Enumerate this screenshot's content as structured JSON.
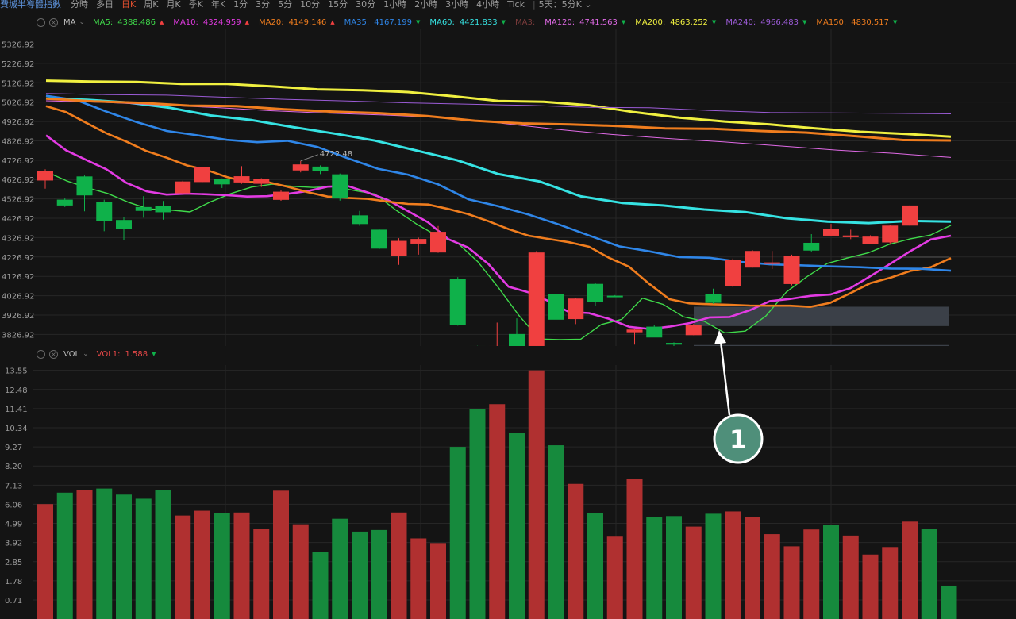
{
  "header": {
    "title": "費城半導體指數",
    "timeframes": [
      "分時",
      "多日",
      "日K",
      "周K",
      "月K",
      "季K",
      "年K",
      "1分",
      "3分",
      "5分",
      "10分",
      "15分",
      "30分",
      "1小時",
      "2小時",
      "3小時",
      "4小時",
      "Tick"
    ],
    "active_timeframe": "日K",
    "range_label": "5天：5分K",
    "range_chevron": "⌄"
  },
  "price_legend": {
    "label": "MA",
    "items": [
      {
        "name": "MA5:",
        "value": "4388.486",
        "color": "#3fd94a",
        "dir": "▲"
      },
      {
        "name": "MA10:",
        "value": "4324.959",
        "color": "#e33be3",
        "dir": "▲"
      },
      {
        "name": "MA20:",
        "value": "4149.146",
        "color": "#f07d1e",
        "dir": "▲"
      },
      {
        "name": "MA35:",
        "value": "4167.199",
        "color": "#2f86e8",
        "dir": "▼"
      },
      {
        "name": "MA60:",
        "value": "4421.833",
        "color": "#36e3e3",
        "dir": "▼"
      },
      {
        "name": "MA3:",
        "value": "",
        "color": "#7a3b3b",
        "dir": ""
      },
      {
        "name": "MA120:",
        "value": "4741.563",
        "color": "#e06ae6",
        "dir": "▼"
      },
      {
        "name": "MA200:",
        "value": "4863.252",
        "color": "#f0f040",
        "dir": "▼"
      },
      {
        "name": "MA240:",
        "value": "4966.483",
        "color": "#9b5bd6",
        "dir": "▼"
      },
      {
        "name": "MA150:",
        "value": "4830.517",
        "color": "#f07d1e",
        "dir": "▼"
      }
    ]
  },
  "volume_legend": {
    "label": "VOL",
    "items": [
      {
        "name": "VOL1:",
        "value": "1.588",
        "color": "#e84848",
        "dir": "▼"
      }
    ]
  },
  "annotation": {
    "label": "1",
    "max_price_label": "4722.48"
  },
  "colors": {
    "up": "#f04040",
    "down": "#0fb14a",
    "up_vol": "#b03030",
    "down_vol": "#168a3d",
    "grid": "#262626",
    "axis_text": "#9a9a9a"
  },
  "chart_data": [
    {
      "type": "candlestick",
      "title": "",
      "ylim": [
        3766.92,
        5406.92
      ],
      "y_ticks": [
        "5326.92",
        "5226.92",
        "5126.92",
        "5026.92",
        "4926.92",
        "4826.92",
        "4726.92",
        "4626.92",
        "4526.92",
        "4426.92",
        "4326.92",
        "4226.92",
        "4126.92",
        "4026.92",
        "3926.92",
        "3826.92"
      ],
      "candles": [
        {
          "o": 4622,
          "c": 4672,
          "h": 4680,
          "l": 4580
        },
        {
          "o": 4523,
          "c": 4493,
          "h": 4530,
          "l": 4485
        },
        {
          "o": 4643,
          "c": 4545,
          "h": 4648,
          "l": 4463
        },
        {
          "o": 4510,
          "c": 4412,
          "h": 4523,
          "l": 4360
        },
        {
          "o": 4418,
          "c": 4372,
          "h": 4433,
          "l": 4312
        },
        {
          "o": 4485,
          "c": 4465,
          "h": 4541,
          "l": 4430
        },
        {
          "o": 4492,
          "c": 4458,
          "h": 4516,
          "l": 4420
        },
        {
          "o": 4556,
          "c": 4617,
          "h": 4621,
          "l": 4551
        },
        {
          "o": 4614,
          "c": 4693,
          "h": 4693,
          "l": 4614
        },
        {
          "o": 4628,
          "c": 4602,
          "h": 4633,
          "l": 4583
        },
        {
          "o": 4612,
          "c": 4644,
          "h": 4696,
          "l": 4605
        },
        {
          "o": 4605,
          "c": 4629,
          "h": 4634,
          "l": 4588
        },
        {
          "o": 4522,
          "c": 4564,
          "h": 4574,
          "l": 4517
        },
        {
          "o": 4674,
          "c": 4705,
          "h": 4723,
          "l": 4664
        },
        {
          "o": 4694,
          "c": 4671,
          "h": 4700,
          "l": 4655
        },
        {
          "o": 4654,
          "c": 4529,
          "h": 4658,
          "l": 4518
        },
        {
          "o": 4442,
          "c": 4397,
          "h": 4465,
          "l": 4388
        },
        {
          "o": 4368,
          "c": 4270,
          "h": 4373,
          "l": 4267
        },
        {
          "o": 4232,
          "c": 4310,
          "h": 4324,
          "l": 4186
        },
        {
          "o": 4296,
          "c": 4320,
          "h": 4327,
          "l": 4239
        },
        {
          "o": 4250,
          "c": 4357,
          "h": 4387,
          "l": 4248
        },
        {
          "o": 4112,
          "c": 3877,
          "h": 4123,
          "l": 3872
        },
        {
          "o": 3767,
          "c": 3750,
          "h": 3768,
          "l": 3690
        },
        {
          "o": 3767,
          "c": 3767,
          "h": 3888,
          "l": 3767
        },
        {
          "o": 3829,
          "c": 3760,
          "h": 3910,
          "l": 3744
        },
        {
          "o": 3767,
          "c": 4250,
          "h": 4257,
          "l": 3767
        },
        {
          "o": 4035,
          "c": 3903,
          "h": 4046,
          "l": 3890
        },
        {
          "o": 3906,
          "c": 4012,
          "h": 4015,
          "l": 3880
        },
        {
          "o": 4088,
          "c": 3995,
          "h": 4095,
          "l": 3974
        },
        {
          "o": 4027,
          "c": 4022,
          "h": 4030,
          "l": 4021
        },
        {
          "o": 3838,
          "c": 3852,
          "h": 3855,
          "l": 3774
        },
        {
          "o": 3867,
          "c": 3811,
          "h": 3874,
          "l": 3812
        },
        {
          "o": 3783,
          "c": 3774,
          "h": 3786,
          "l": 3766
        },
        {
          "o": 3823,
          "c": 3874,
          "h": 3881,
          "l": 3823
        },
        {
          "o": 4037,
          "c": 3990,
          "h": 4063,
          "l": 3985
        },
        {
          "o": 4077,
          "c": 4213,
          "h": 4219,
          "l": 4072
        },
        {
          "o": 4172,
          "c": 4258,
          "h": 4262,
          "l": 4172
        },
        {
          "o": 4193,
          "c": 4199,
          "h": 4258,
          "l": 4165
        },
        {
          "o": 4087,
          "c": 4232,
          "h": 4239,
          "l": 4080
        },
        {
          "o": 4300,
          "c": 4260,
          "h": 4345,
          "l": 4255
        },
        {
          "o": 4337,
          "c": 4371,
          "h": 4398,
          "l": 4335
        },
        {
          "o": 4329,
          "c": 4338,
          "h": 4368,
          "l": 4319
        },
        {
          "o": 4295,
          "c": 4332,
          "h": 4339,
          "l": 4295
        },
        {
          "o": 4302,
          "c": 4389,
          "h": 4392,
          "l": 4295
        },
        {
          "o": 4389,
          "c": 4493,
          "h": 4493,
          "l": 4389
        }
      ],
      "ma": [
        {
          "name": "MA5",
          "color": "#3fd94a",
          "width": 1.4,
          "values": [
            4668,
            4620,
            4585,
            4555,
            4510,
            4475,
            4470,
            4460,
            4512,
            4555,
            4588,
            4603,
            4592,
            4586,
            4590,
            4570,
            4552,
            4470,
            4398,
            4337,
            4300,
            4202,
            4068,
            3924,
            3803,
            3800,
            3802,
            3878,
            3905,
            4014,
            3982,
            3918,
            3895,
            3835,
            3844,
            3922,
            4046,
            4125,
            4194,
            4223,
            4249,
            4292,
            4320,
            4340,
            4390
          ]
        },
        {
          "name": "MA10",
          "color": "#e33be3",
          "width": 2.6,
          "values": [
            4855,
            4778,
            4728,
            4680,
            4610,
            4566,
            4549,
            4554,
            4551,
            4546,
            4539,
            4541,
            4553,
            4567,
            4590,
            4594,
            4560,
            4521,
            4464,
            4406,
            4319,
            4275,
            4191,
            4073,
            4044,
            3999,
            3943,
            3937,
            3907,
            3866,
            3855,
            3867,
            3885,
            3915,
            3917,
            3952,
            3999,
            4010,
            4026,
            4033,
            4066,
            4128,
            4193,
            4258,
            4317,
            4337
          ]
        },
        {
          "name": "MA20",
          "color": "#f07d1e",
          "width": 2.6,
          "values": [
            5006,
            4975,
            4920,
            4866,
            4823,
            4774,
            4740,
            4700,
            4676,
            4640,
            4614,
            4614,
            4590,
            4562,
            4539,
            4532,
            4527,
            4513,
            4501,
            4498,
            4475,
            4448,
            4412,
            4371,
            4337,
            4320,
            4303,
            4280,
            4223,
            4176,
            4088,
            4009,
            3987,
            3983,
            3980,
            3976,
            3975,
            3975,
            3969,
            3990,
            4040,
            4092,
            4120,
            4155,
            4174,
            4221
          ]
        },
        {
          "name": "MA35",
          "color": "#2f86e8",
          "width": 2.6,
          "values": [
            5060,
            5038,
            4978,
            4924,
            4878,
            4856,
            4832,
            4820,
            4827,
            4795,
            4737,
            4683,
            4652,
            4602,
            4525,
            4489,
            4446,
            4395,
            4338,
            4282,
            4256,
            4226,
            4223,
            4202,
            4189,
            4184,
            4178,
            4174,
            4167,
            4166,
            4156
          ]
        },
        {
          "name": "MA60",
          "color": "#36e3e3",
          "width": 3,
          "values": [
            5046,
            5039,
            5025,
            4998,
            4958,
            4934,
            4898,
            4865,
            4828,
            4777,
            4726,
            4655,
            4617,
            4540,
            4506,
            4493,
            4472,
            4459,
            4427,
            4410,
            4402,
            4413,
            4410
          ]
        },
        {
          "name": "MA120",
          "color": "#e06ae6",
          "width": 1,
          "values": [
            5034,
            5026,
            5012,
            4999,
            4982,
            4970,
            4960,
            4947,
            4920,
            4887,
            4860,
            4839,
            4821,
            4800,
            4779,
            4762,
            4741
          ]
        },
        {
          "name": "MA150",
          "color": "#f07d1e",
          "width": 3,
          "values": [
            5045,
            5031,
            5023,
            5009,
            5006,
            4990,
            4978,
            4970,
            4955,
            4931,
            4917,
            4912,
            4904,
            4891,
            4889,
            4878,
            4869,
            4851,
            4831,
            4829
          ]
        },
        {
          "name": "MA200",
          "color": "#f0f040",
          "width": 3,
          "values": [
            5138,
            5133,
            5131,
            5121,
            5121,
            5108,
            5093,
            5088,
            5079,
            5057,
            5033,
            5029,
            5011,
            4975,
            4947,
            4927,
            4912,
            4891,
            4874,
            4863,
            4848
          ]
        },
        {
          "name": "MA240",
          "color": "#9b5bd6",
          "width": 1,
          "values": [
            5072,
            5066,
            5063,
            5052,
            5041,
            5033,
            5023,
            5016,
            5010,
            5000,
            4998,
            4984,
            4973,
            4971,
            4969,
            4966
          ]
        }
      ]
    },
    {
      "type": "bar",
      "title": "",
      "ylim": [
        0,
        14.2
      ],
      "y_ticks": [
        "13.55",
        "12.48",
        "11.41",
        "10.34",
        "9.27",
        "8.20",
        "7.13",
        "6.06",
        "4.99",
        "3.92",
        "2.85",
        "1.78",
        "0.71"
      ],
      "values": [
        6.07,
        6.71,
        6.84,
        6.94,
        6.6,
        6.37,
        6.87,
        5.43,
        5.7,
        5.55,
        5.6,
        4.66,
        6.82,
        4.94,
        3.41,
        5.25,
        4.53,
        4.62,
        5.6,
        4.15,
        3.89,
        9.27,
        11.36,
        11.66,
        10.05,
        13.55,
        9.36,
        7.2,
        5.55,
        4.25,
        7.49,
        5.36,
        5.4,
        4.81,
        5.53,
        5.66,
        5.35,
        4.39,
        3.71,
        4.65,
        4.91,
        4.31,
        3.25,
        3.67,
        5.09,
        4.66,
        1.51
      ],
      "colors_up": [
        true,
        false,
        true,
        false,
        false,
        false,
        false,
        true,
        true,
        false,
        true,
        true,
        true,
        true,
        false,
        false,
        false,
        false,
        true,
        true,
        true,
        false,
        false,
        true,
        false,
        true,
        false,
        true,
        false,
        true,
        true,
        false,
        false,
        true,
        false,
        true,
        true,
        true,
        true,
        true,
        false,
        true,
        true,
        true,
        true,
        false,
        false
      ]
    }
  ]
}
